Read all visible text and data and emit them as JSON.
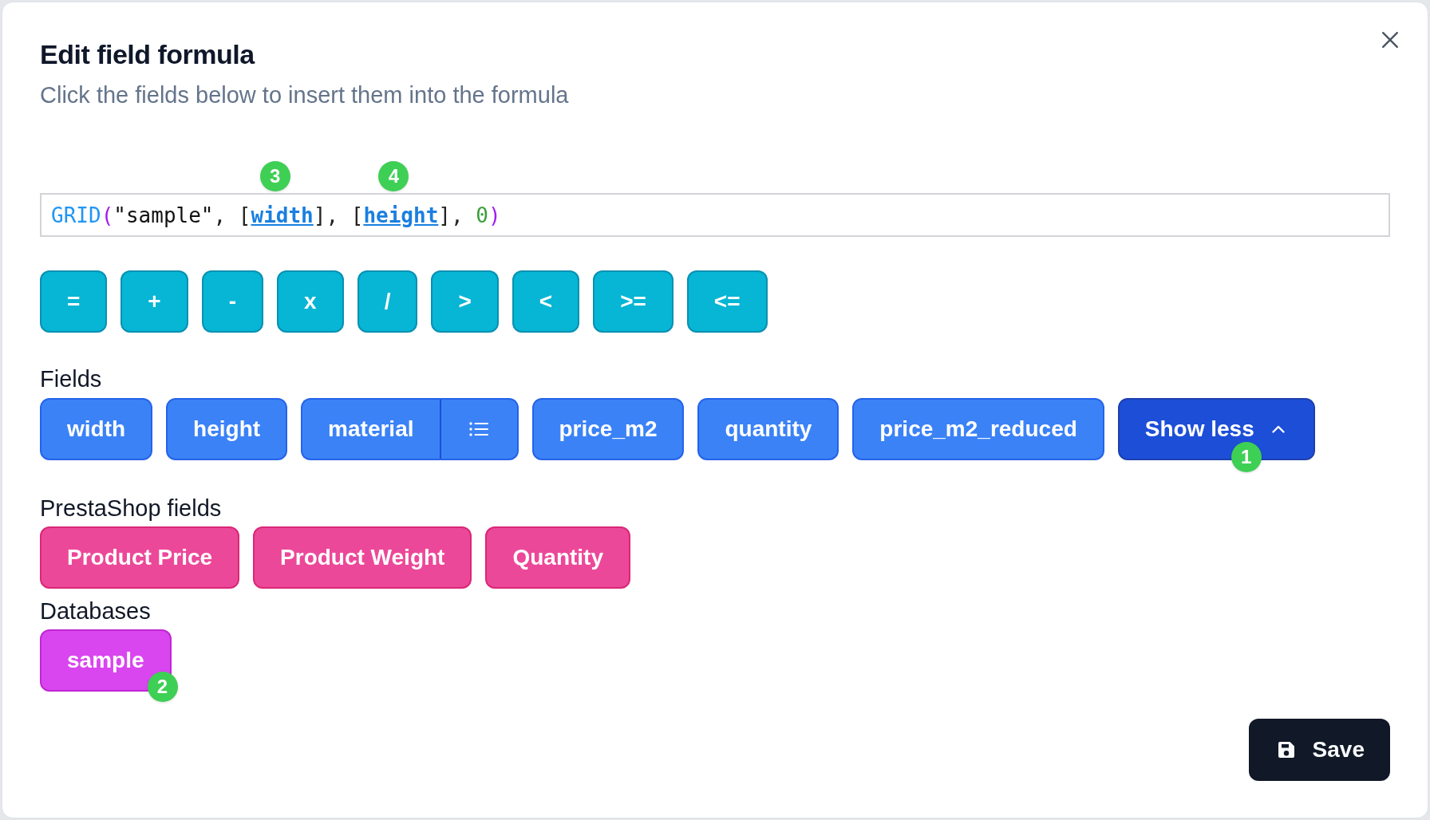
{
  "dialog": {
    "title": "Edit field formula",
    "subtitle": "Click the fields below to insert them into the formula"
  },
  "formula": {
    "tokens": [
      {
        "kind": "function",
        "text": "GRID"
      },
      {
        "kind": "paren",
        "text": "("
      },
      {
        "kind": "string",
        "text": "\"sample\""
      },
      {
        "kind": "plain",
        "text": ", ["
      },
      {
        "kind": "field",
        "text": "width",
        "badge": "3"
      },
      {
        "kind": "plain",
        "text": "], ["
      },
      {
        "kind": "field",
        "text": "height",
        "badge": "4"
      },
      {
        "kind": "plain",
        "text": "], "
      },
      {
        "kind": "number",
        "text": "0"
      },
      {
        "kind": "paren",
        "text": ")"
      }
    ]
  },
  "operators": [
    "=",
    "+",
    "-",
    "x",
    "/",
    ">",
    "<",
    ">=",
    "<="
  ],
  "fields": {
    "label": "Fields",
    "items": [
      {
        "kind": "plain",
        "label": "width"
      },
      {
        "kind": "plain",
        "label": "height"
      },
      {
        "kind": "list",
        "label": "material"
      },
      {
        "kind": "plain",
        "label": "price_m2"
      },
      {
        "kind": "plain",
        "label": "quantity"
      },
      {
        "kind": "plain",
        "label": "price_m2_reduced"
      }
    ],
    "toggle": {
      "label": "Show less",
      "expanded": true,
      "badge": "1"
    }
  },
  "prestashop_fields": {
    "label": "PrestaShop fields",
    "items": [
      "Product Price",
      "Product Weight",
      "Quantity"
    ]
  },
  "databases": {
    "label": "Databases",
    "items": [
      {
        "label": "sample",
        "badge": "2"
      }
    ]
  },
  "save_button": {
    "label": "Save"
  }
}
